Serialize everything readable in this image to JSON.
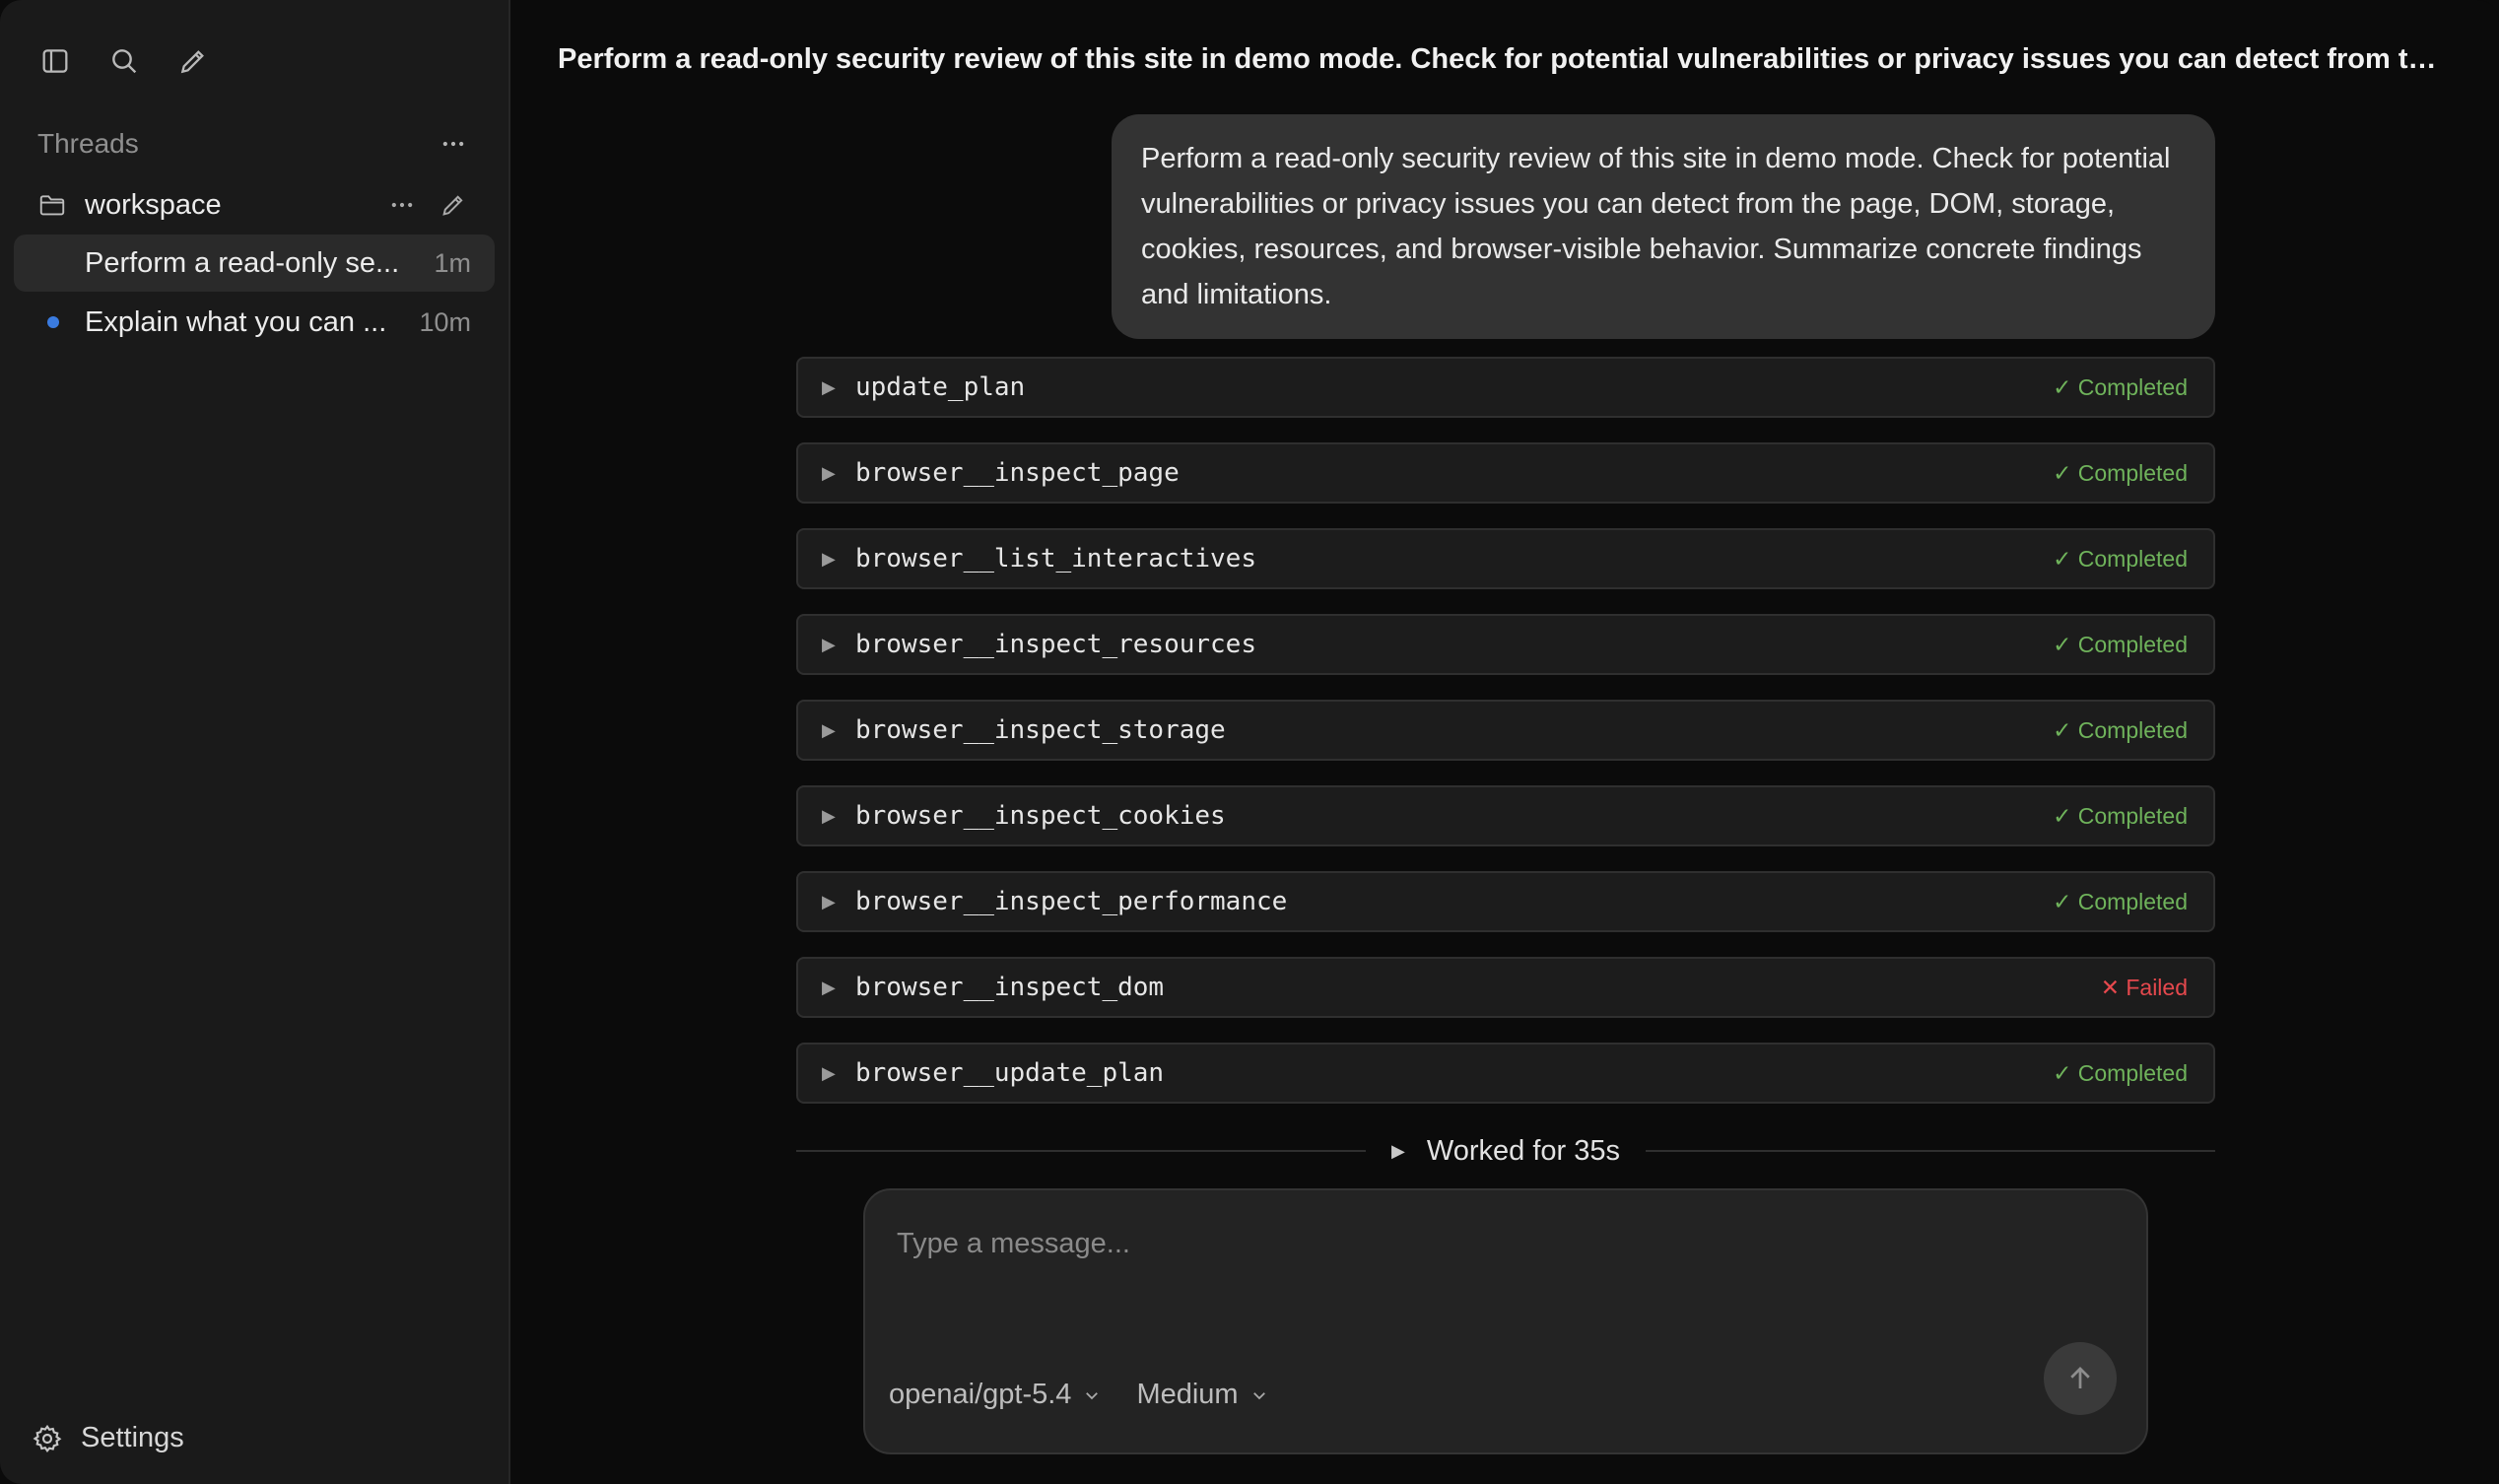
{
  "sidebar": {
    "threads_title": "Threads",
    "folder": {
      "name": "workspace"
    },
    "threads": [
      {
        "title": "Perform a read-only se...",
        "time": "1m",
        "active": true
      },
      {
        "title": "Explain what you can ...",
        "time": "10m",
        "unread": true
      }
    ],
    "settings_label": "Settings"
  },
  "main": {
    "thread_title": "Perform a read-only security review of this site in demo mode. Check for potential vulnerabilities or privacy issues you can detect from the page...",
    "user_message": "Perform a read-only security review of this site in demo mode. Check for potential vulnerabilities or privacy issues you can detect from the page, DOM, storage, cookies, resources, and browser-visible behavior. Summarize concrete findings and limitations.",
    "tools": [
      {
        "name": "update_plan",
        "status": "✓ Completed",
        "state": "ok"
      },
      {
        "name": "browser__inspect_page",
        "status": "✓ Completed",
        "state": "ok"
      },
      {
        "name": "browser__list_interactives",
        "status": "✓ Completed",
        "state": "ok"
      },
      {
        "name": "browser__inspect_resources",
        "status": "✓ Completed",
        "state": "ok"
      },
      {
        "name": "browser__inspect_storage",
        "status": "✓ Completed",
        "state": "ok"
      },
      {
        "name": "browser__inspect_cookies",
        "status": "✓ Completed",
        "state": "ok"
      },
      {
        "name": "browser__inspect_performance",
        "status": "✓ Completed",
        "state": "ok"
      },
      {
        "name": "browser__inspect_dom",
        "status": "✕ Failed",
        "state": "fail"
      },
      {
        "name": "browser__update_plan",
        "status": "✓ Completed",
        "state": "ok"
      }
    ],
    "tool_expand_glyph": "▶",
    "worked_label": "Worked for 35s"
  },
  "composer": {
    "placeholder": "Type a message...",
    "model": "openai/gpt-5.4",
    "effort": "Medium"
  },
  "colors": {
    "status_ok": "#6fb35b",
    "status_fail": "#e5484d",
    "unread_dot": "#3a7be0"
  }
}
